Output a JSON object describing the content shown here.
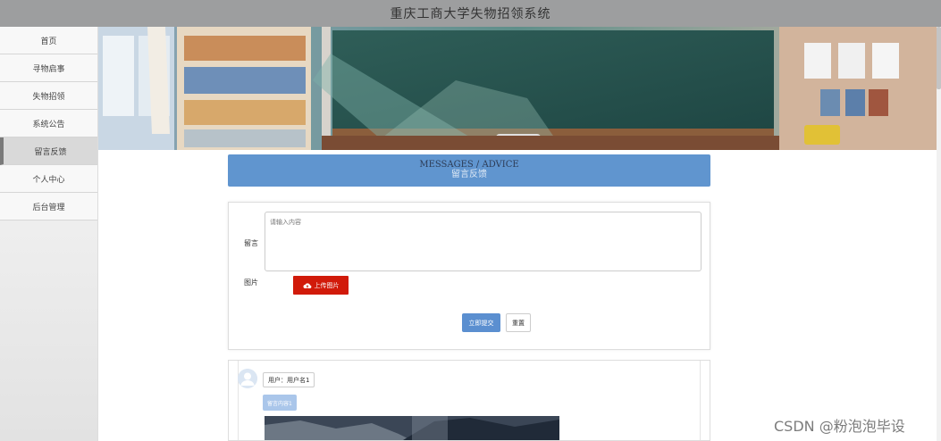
{
  "app": {
    "title": "重庆工商大学失物招领系统"
  },
  "sidebar": {
    "items": [
      {
        "label": "首页"
      },
      {
        "label": "寻物启事"
      },
      {
        "label": "失物招领"
      },
      {
        "label": "系统公告"
      },
      {
        "label": "留言反馈"
      },
      {
        "label": "个人中心"
      },
      {
        "label": "后台管理"
      }
    ],
    "active_index": 4
  },
  "section_header": {
    "title_en": "MESSAGES / ADVICE",
    "title_cn": "留言反馈"
  },
  "form": {
    "message_label": "留言",
    "message_placeholder": "请输入内容",
    "image_label": "图片",
    "upload_label": "上传图片",
    "submit_label": "立即提交",
    "reset_label": "重置"
  },
  "comment": {
    "user_text": "用户：用户名1",
    "content_text": "留言内容1"
  },
  "watermark": {
    "text": "CSDN @粉泡泡毕设"
  },
  "colors": {
    "topbar": "#9d9e9f",
    "header_blue": "#6095cf",
    "upload_red": "#d11a0a",
    "submit_blue": "#5b8fd0"
  }
}
